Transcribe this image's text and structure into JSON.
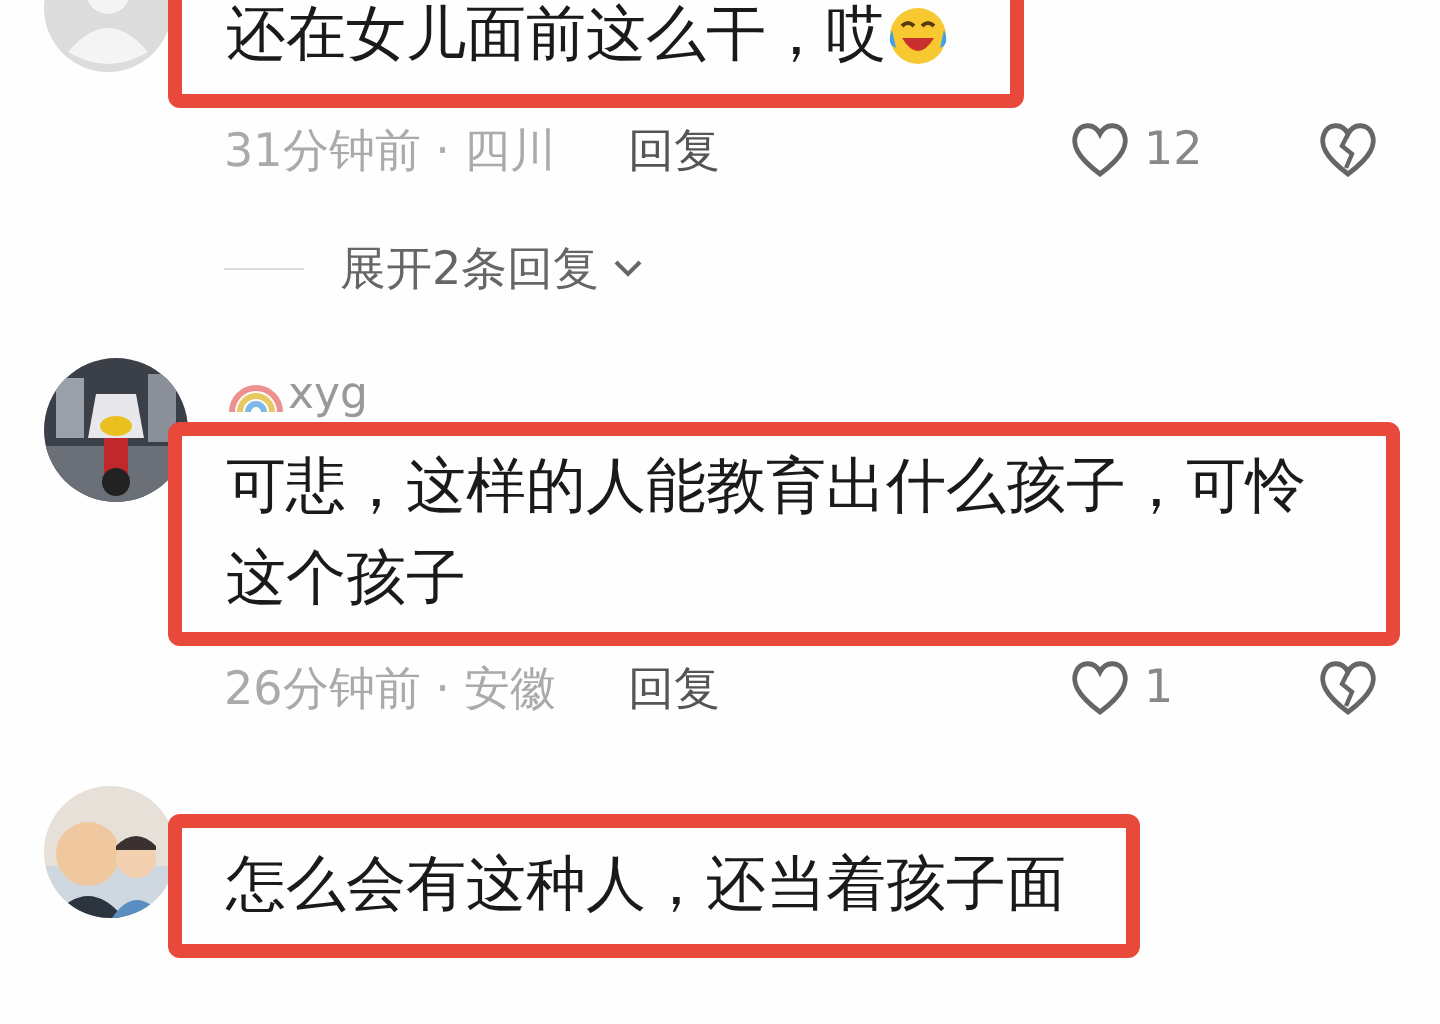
{
  "comments": [
    {
      "avatar": {
        "kind": "default"
      },
      "text": "还在女儿面前这么干，哎",
      "trailing_emoji": true,
      "highlighted": true,
      "meta": "31分钟前 · 四川",
      "reply": "回复",
      "likes": "12",
      "expand_replies": "展开2条回复"
    },
    {
      "username": "xyg",
      "text": "可悲，这样的人能教育出什么孩子，可怜这个孩子",
      "highlighted": true,
      "meta": "26分钟前 · 安徽",
      "reply": "回复",
      "likes": "1"
    },
    {
      "text": "怎么会有这种人，还当着孩子面",
      "highlighted": true
    }
  ]
}
